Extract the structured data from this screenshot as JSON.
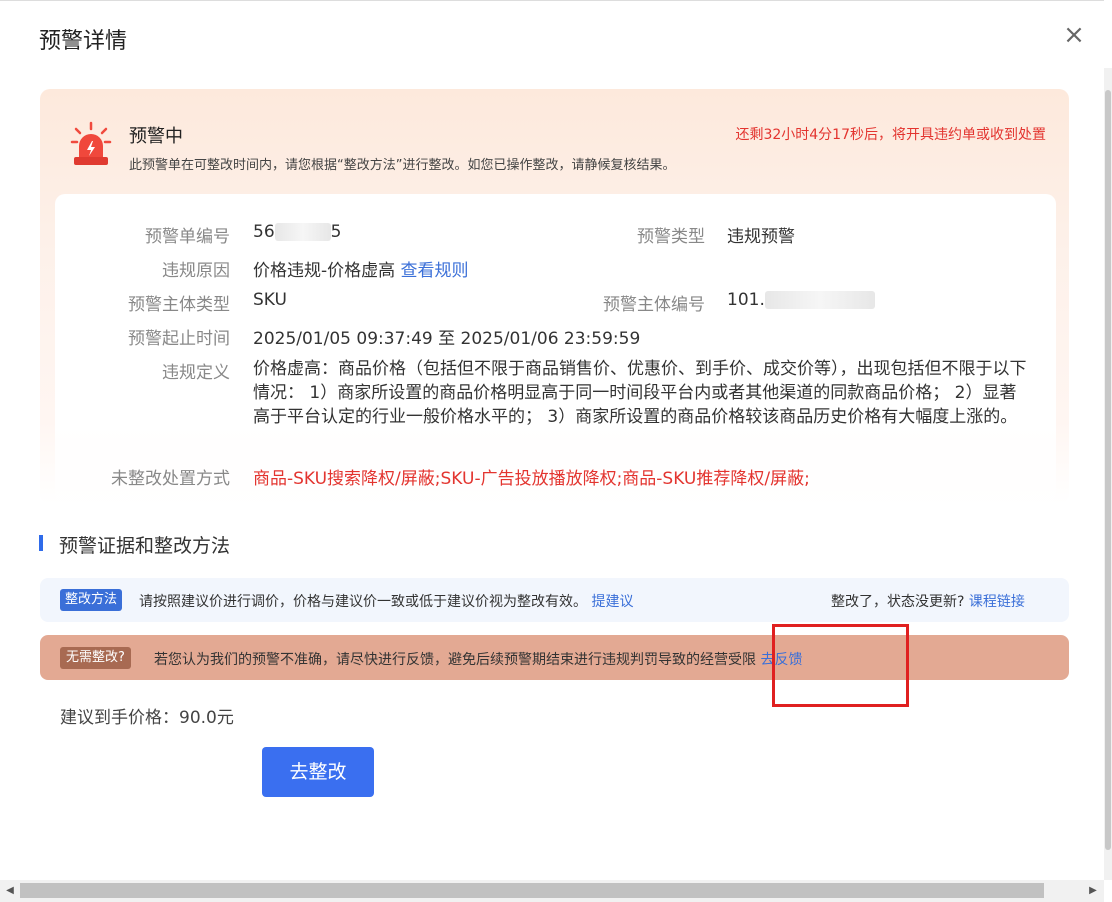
{
  "dialog": {
    "title": "预警详情",
    "close_label": "×"
  },
  "status": {
    "title": "预警中",
    "description": "此预警单在可整改时间内，请您根据“整改方法”进行整改。如您已操作整改，请静候复核结果。",
    "countdown": "还剩32小时4分17秒后，将开具违约单或收到处置"
  },
  "info": {
    "order_no_label": "预警单编号",
    "order_no_prefix": "56",
    "order_no_suffix": "5",
    "type_label": "预警类型",
    "type_value": "违规预警",
    "reason_label": "违规原因",
    "reason_value": "价格违规-价格虚高",
    "reason_link": "查看规则",
    "subject_type_label": "预警主体类型",
    "subject_type_value": "SKU",
    "subject_no_label": "预警主体编号",
    "subject_no_prefix": "101.",
    "period_label": "预警起止时间",
    "period_value": "2025/01/05 09:37:49 至 2025/01/06 23:59:59",
    "definition_label": "违规定义",
    "definition_value": "价格虚高：商品价格（包括但不限于商品销售价、优惠价、到手价、成交价等），出现包括但不限于以下情况： 1）商家所设置的商品价格明显高于同一时间段平台内或者其他渠道的同款商品价格； 2）显著高于平台认定的行业一般价格水平的； 3）商家所设置的商品价格较该商品历史价格有大幅度上涨的。",
    "disposal_label": "未整改处置方式",
    "disposal_value": "商品-SKU搜索降权/屏蔽;SKU-广告投放播放降权;商品-SKU推荐降权/屏蔽;"
  },
  "section": {
    "title": "预警证据和整改方法"
  },
  "method": {
    "tag": "整改方法",
    "text": "请按照建议价进行调价，价格与建议价一致或低于建议价视为整改有效。",
    "link": "提建议",
    "right_text": "整改了，状态没更新?",
    "right_link": "课程链接"
  },
  "feedback": {
    "tag": "无需整改?",
    "text": "若您认为我们的预警不准确，请尽快进行反馈，避免后续预警期结束进行违规判罚导致的经营受限",
    "link": "去反馈"
  },
  "price": {
    "text": "建议到手价格：90.0元"
  },
  "action": {
    "button_label": "去整改"
  },
  "colors": {
    "accent": "#3a6fd8",
    "danger": "#e3342f",
    "feedback_bg": "#e3a993",
    "button": "#3a6ff0"
  },
  "icons": {
    "siren": "alarm-siren-icon",
    "close": "close-icon"
  }
}
